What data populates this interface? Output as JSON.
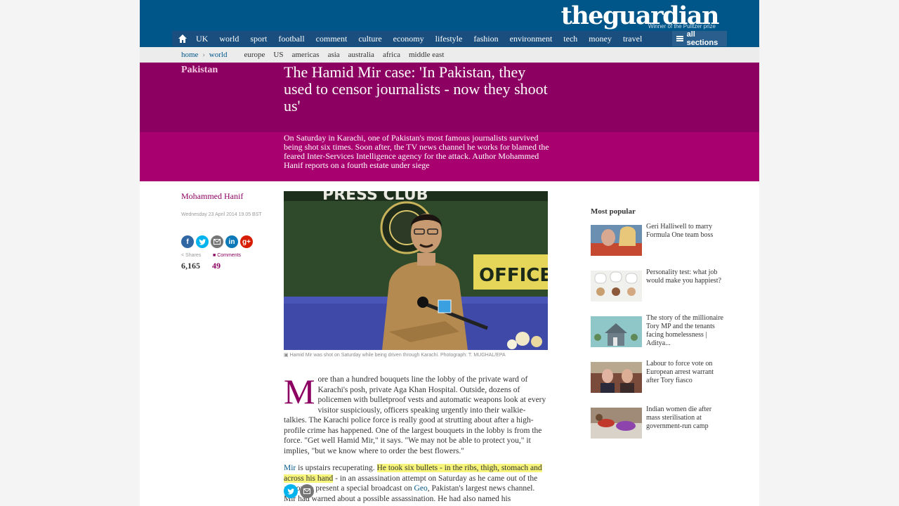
{
  "brand": {
    "logo": "theguardian",
    "tagline": "Winner of the Pulitzer prize",
    "color_primary": "#005689",
    "color_accent": "#8b0061"
  },
  "nav": {
    "items": [
      "UK",
      "world",
      "sport",
      "football",
      "comment",
      "culture",
      "economy",
      "lifestyle",
      "fashion",
      "environment",
      "tech",
      "money",
      "travel"
    ],
    "all_sections": "all sections"
  },
  "subnav": {
    "crumb_home": "home",
    "crumb_world": "world",
    "items": [
      "europe",
      "US",
      "americas",
      "asia",
      "australia",
      "africa",
      "middle east"
    ]
  },
  "article": {
    "section": "Pakistan",
    "headline": "The Hamid Mir case: 'In Pakistan, they used to censor journalists - now they shoot us'",
    "standfirst": "On Saturday in Karachi, one of Pakistan's most famous journalists survived being shot six times. Soon after, the TV news channel he works for blamed the feared Inter-Services Intelligence agency for the attack. Author Mohammed Hanif reports on a fourth estate under siege",
    "author": "Mohammed Hanif",
    "date": "Wednesday 23 April 2014 19.05 BST",
    "shares_label": "Shares",
    "shares": "6,165",
    "comments_label": "Comments",
    "comments": "49",
    "caption": "Hamid Mir was shot on Saturday while being driven through Karachi. Photograph: T. MUGHAL/EPA",
    "image_text": {
      "banner": "PRESS CLUB",
      "sign": "OFFICE"
    },
    "dropcap": "M",
    "para1": "ore than a hundred bouquets line the lobby of the private ward of Karachi's posh, private Aga Khan Hospital. Outside, dozens of policemen with bulletproof vests and automatic weapons look at every visitor suspiciously, officers speaking urgently into their walkie-talkies. The Karachi police force is really good at strutting about after a high-profile crime has happened. One of the largest bouquets in the lobby is from the force. \"Get well Hamid Mir,\" it says. \"We may not be able to protect you,\" it implies, \"but we know where to order the best flowers.\"",
    "para2_link1": "Mir",
    "para2_a": " is upstairs recuperating. ",
    "para2_highlight": "He took six bullets - in the ribs, thigh, stomach and across his hand",
    "para2_b": " - in an assassination attempt on Saturday as he came out of the airport to present a special broadcast on ",
    "para2_link2": "Geo",
    "para2_c": ", Pakistan's largest news channel. Mir had warned about a possible assassination. He had also named his"
  },
  "most_popular": {
    "title": "Most popular",
    "items": [
      {
        "text": "Geri Halliwell to marry Formula One team boss"
      },
      {
        "text": "Personality test: what job would make you happiest?"
      },
      {
        "text": "The story of the millionaire Tory MP and the tenants facing homelessness | Aditya..."
      },
      {
        "text": "Labour to force vote on European arrest warrant after Tory fiasco"
      },
      {
        "text": "Indian women die after mass sterilisation at government-run camp"
      }
    ]
  }
}
